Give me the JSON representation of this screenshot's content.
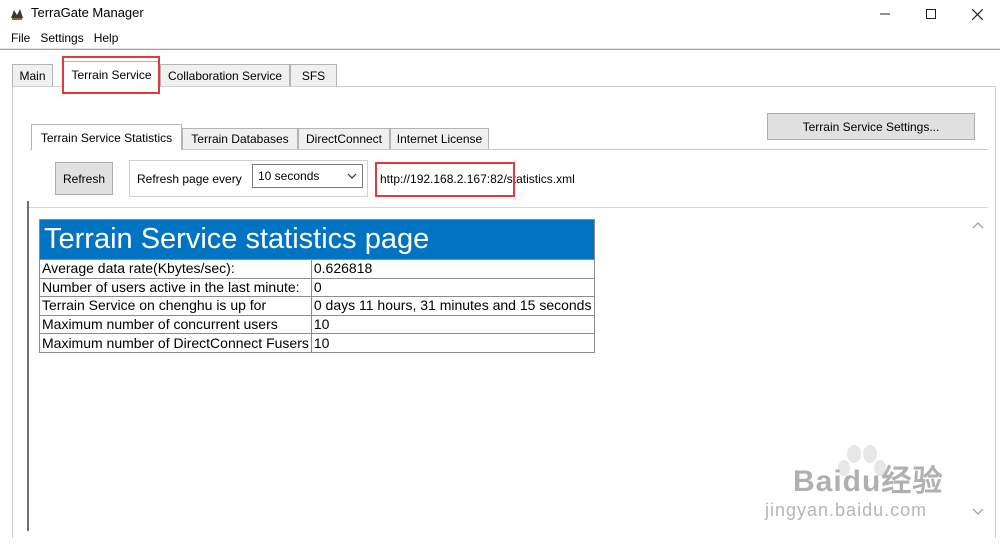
{
  "window": {
    "title": "TerraGate Manager"
  },
  "menu": {
    "items": [
      "File",
      "Settings",
      "Help"
    ]
  },
  "outer_tabs": [
    "Main",
    "Terrain Service",
    "Collaboration Service",
    "SFS"
  ],
  "inner_tabs": [
    "Terrain Service Statistics",
    "Terrain Databases",
    "DirectConnect",
    "Internet License"
  ],
  "toolbar": {
    "settings_button": "Terrain Service Settings...",
    "refresh_button": "Refresh",
    "refresh_label": "Refresh page every",
    "interval_selected": "10 seconds",
    "url_host": "http://192.168.2.167:82",
    "url_path": "/statistics.xml"
  },
  "stats": {
    "title": "Terrain Service statistics page",
    "rows": [
      {
        "label": "Average data rate(Kbytes/sec):",
        "value": "0.626818"
      },
      {
        "label": "Number of users active in the last minute:",
        "value": "0"
      },
      {
        "label": "Terrain Service on chenghu is up for",
        "value": "0 days 11 hours, 31 minutes and 15 seconds"
      },
      {
        "label": "Maximum number of concurrent users",
        "value": "10"
      },
      {
        "label": "Maximum number of DirectConnect Fusers",
        "value": "10"
      }
    ]
  },
  "watermark": {
    "brand": "Baidu经验",
    "site": "jingyan.baidu.com"
  },
  "colors": {
    "stats_header": "#0074c2",
    "highlight": "#e2393c"
  }
}
